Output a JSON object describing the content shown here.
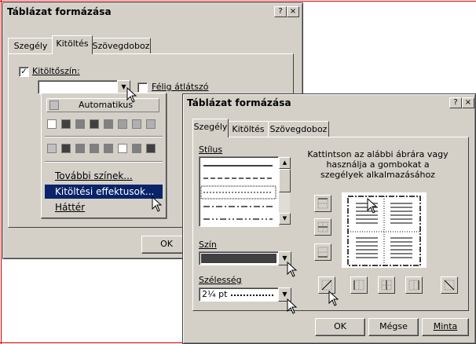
{
  "colors": {
    "dialog_bg": "#d4d0c8",
    "highlight": "#0a246a",
    "frame_red": "#cc0000"
  },
  "back_dialog": {
    "title": "Táblázat formázása",
    "help_btn": "?",
    "close_btn": "×",
    "tabs": [
      "Szegély",
      "Kitöltés",
      "Szövegdoboz"
    ],
    "active_tab": "Kitöltés",
    "fill_checkbox_label": "Kitöltőszín:",
    "fill_checked": true,
    "half_transparent_label": "Félig átlátszó",
    "half_transparent_checked": false,
    "ok_label": "OK",
    "color_menu": {
      "automatic_label": "Automatikus",
      "more_colors": "További színek...",
      "fill_effects": "Kitöltési effektusok...",
      "background": "Háttér",
      "row1_colors": [
        "#ffffff",
        "#404040",
        "#808080",
        "#404040",
        "#808080",
        "#a0a0a0",
        "#b0b0b0",
        "#b0b0b0"
      ],
      "row2_colors": [
        "#c0c0c0",
        "#404040",
        "#808080",
        "#808080",
        "#808080",
        "#ffffff",
        "#808080",
        "#404040"
      ]
    }
  },
  "front_dialog": {
    "title": "Táblázat formázása",
    "help_btn": "?",
    "close_btn": "×",
    "tabs": [
      "Szegély",
      "Kitöltés",
      "Szövegdoboz"
    ],
    "active_tab": "Szegély",
    "style_label": "Stílus",
    "color_label": "Szín",
    "width_label": "Szélesség",
    "width_value": "2¼ pt",
    "instructions": "Kattintson az alábbi ábrára vagy használja a gombokat a szegélyek alkalmazásához",
    "ok_label": "OK",
    "cancel_label": "Mégse",
    "preview_label": "Minta"
  }
}
